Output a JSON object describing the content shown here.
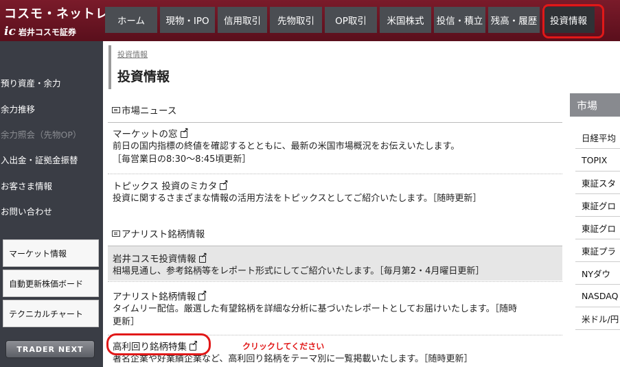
{
  "logo": {
    "name": "コスモ・ネットレ",
    "brand_mark": "ic",
    "brand": "岩井コスモ証券"
  },
  "nav": {
    "tabs": [
      {
        "label": "ホーム"
      },
      {
        "label": "現物・IPO"
      },
      {
        "label": "信用取引"
      },
      {
        "label": "先物取引"
      },
      {
        "label": "OP取引"
      },
      {
        "label": "米国株式"
      },
      {
        "label": "投信・積立"
      },
      {
        "label": "残高・履歴"
      },
      {
        "label": "投資情報",
        "active": true
      }
    ]
  },
  "sidebar": {
    "links": [
      {
        "label": "預り資産・余力"
      },
      {
        "label": "余力推移"
      },
      {
        "label": "余力照会（先物OP）",
        "disabled": true
      },
      {
        "label": "入出金・証拠金振替"
      },
      {
        "label": "お客さま情報"
      },
      {
        "label": "お問い合わせ"
      }
    ],
    "buttons": [
      {
        "label": "マーケット情報"
      },
      {
        "label": "自動更新株価ボード"
      },
      {
        "label": "テクニカルチャート"
      }
    ],
    "trader_next": "TRADER NEXT"
  },
  "main": {
    "breadcrumb": "投資情報",
    "title": "投資情報",
    "sections": [
      {
        "heading": "市場ニュース",
        "items": [
          {
            "title": "マーケットの窓",
            "desc": "前日の国内指標の終値を確認するとともに、最新の米国市場概況をお伝えいたします。",
            "desc2": "［毎営業日の8:30〜8:45頃更新］"
          },
          {
            "title": "トピックス 投資のミカタ",
            "desc": "投資に関するさまざまな情報の活用方法をトピックスとしてご紹介いたします。［随時更新］"
          }
        ]
      },
      {
        "heading": "アナリスト銘柄情報",
        "items": [
          {
            "title": "岩井コスモ投資情報",
            "desc": "相場見通し、参考銘柄等をレポート形式にしてご紹介いたします。［毎月第2・4月曜日更新］"
          },
          {
            "title": "アナリスト銘柄情報",
            "desc": "タイムリー配信。厳選した有望銘柄を詳細な分析に基づいたレポートとしてお届けいたします。［随時",
            "desc2": "更新］"
          },
          {
            "title": "高利回り銘柄特集",
            "desc": "著名企業や好業績企業など、高利回り銘柄をテーマ別に一覧掲載いたします。［随時更新］"
          }
        ]
      }
    ],
    "annotation": "クリックしてください"
  },
  "market_panel": {
    "title": "市場",
    "rows": [
      "日経平均",
      "TOPIX",
      "東証スタ",
      "東証グロ",
      "東証グロ",
      "東証プラ",
      "NYダウ",
      "NASDAQ",
      "米ドル/円"
    ]
  },
  "colors": {
    "header": "#6a1523",
    "sidebar": "#3a3d45",
    "highlight": "#e11818"
  }
}
